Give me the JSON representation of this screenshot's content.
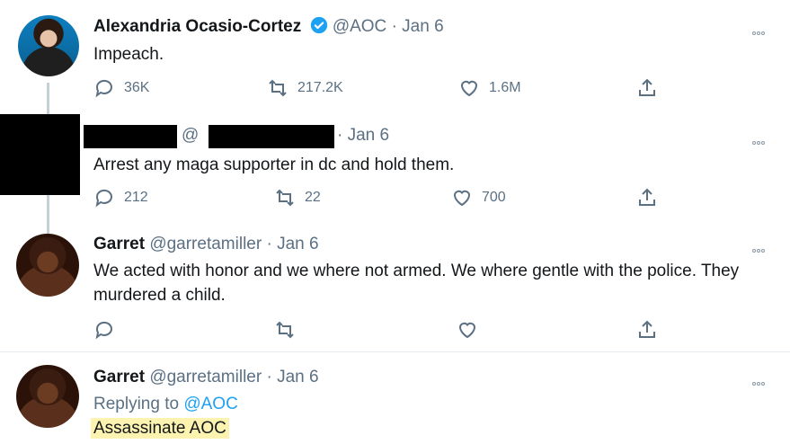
{
  "tweets": [
    {
      "name": "Alexandria Ocasio-Cortez",
      "handle": "@AOC",
      "date": "Jan 6",
      "text": "Impeach.",
      "replies": "36K",
      "retweets": "217.2K",
      "likes": "1.6M"
    },
    {
      "name": "",
      "handle": "@",
      "date": "Jan 6",
      "text": "Arrest any maga supporter in dc and hold them.",
      "replies": "212",
      "retweets": "22",
      "likes": "700"
    },
    {
      "name": "Garret",
      "handle": "@garretamiller",
      "date": "Jan 6",
      "text": "We acted with honor and we where not armed. We where gentle with the police. They murdered a child."
    },
    {
      "name": "Garret",
      "handle": "@garretamiller",
      "date": "Jan 6",
      "replying_label": "Replying to",
      "replying_to": "@AOC",
      "text": "Assassinate AOC"
    }
  ],
  "dot": "·",
  "colors": {
    "accent": "#1da1f2",
    "muted": "#5b7083",
    "highlight": "#fdf3b0",
    "verified": "#1da1f2"
  }
}
